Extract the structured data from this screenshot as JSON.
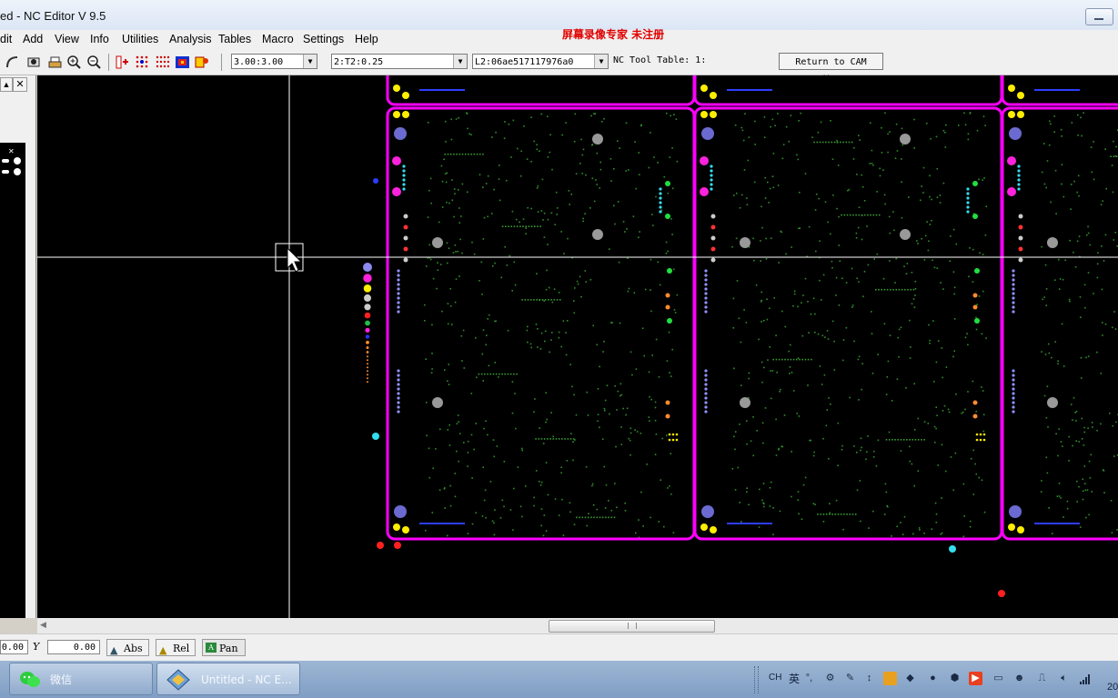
{
  "window": {
    "title": "ed - NC Editor  V 9.5"
  },
  "watermark": "屏幕录像专家 未注册",
  "menu": [
    "dit",
    "Add",
    "View",
    "Info",
    "Utilities",
    "Analysis",
    "Tables",
    "Macro",
    "Settings",
    "Help"
  ],
  "toolbar": {
    "scale_value": "3.00:3.00",
    "tool_value": "2:T2:0.25",
    "layer_value": "L2:06ae517117976a0",
    "nc_tool_table_label": "NC Tool Table: 1:",
    "return_button_label": "Return to CAM Editor"
  },
  "statusbar": {
    "x_value": "0.00",
    "y_label": "Y",
    "y_value": "0.00",
    "abs_label": "Abs",
    "rel_label": "Rel",
    "pan_label": "Pan"
  },
  "taskbar": {
    "wechat_label": "微信",
    "app_label": "Untitled - NC E...",
    "ime_lang": "CH",
    "ime_mode": "英",
    "clock_partial": "20"
  },
  "colors": {
    "board_outline": "#ff00ff",
    "canvas_bg": "#000000",
    "crosshair": "#ffffff",
    "watermark": "#e00000"
  },
  "icons": [
    "close-icon",
    "zoom-in-icon",
    "zoom-out-icon",
    "arrow-pointer-icon",
    "speaker-icon",
    "network-icon"
  ]
}
